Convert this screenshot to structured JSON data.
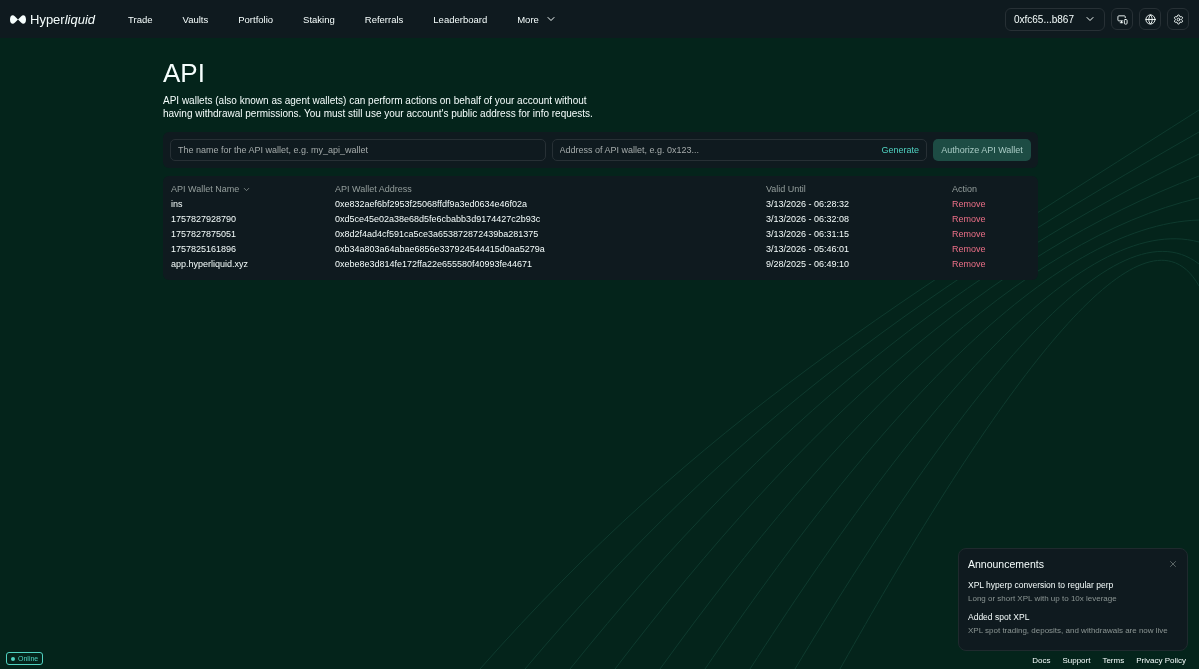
{
  "brand": {
    "name": "Hyper",
    "name_italic": "liquid"
  },
  "nav": [
    {
      "label": "Trade"
    },
    {
      "label": "Vaults"
    },
    {
      "label": "Portfolio"
    },
    {
      "label": "Staking"
    },
    {
      "label": "Referrals"
    },
    {
      "label": "Leaderboard"
    },
    {
      "label": "More",
      "dropdown": true
    }
  ],
  "account": {
    "address": "0xfc65...b867"
  },
  "page": {
    "title": "API",
    "description": "API wallets (also known as agent wallets) can perform actions on behalf of your account without having withdrawal permissions. You must still use your account's public address for info requests."
  },
  "form": {
    "name_field": {
      "placeholder": "The name for the API wallet, e.g. my_api_wallet"
    },
    "address_field": {
      "placeholder": "Address of API wallet, e.g. 0x123..."
    },
    "generate_button": "Generate",
    "authorize_button": {
      "label": "Authorize API Wallet",
      "disabled": true
    }
  },
  "table": {
    "columns": [
      {
        "label": "API Wallet Name",
        "sorted": true
      },
      {
        "label": "API Wallet Address",
        "sorted": false
      },
      {
        "label": "Valid Until",
        "sorted": false
      },
      {
        "label": "Action",
        "sorted": false
      }
    ],
    "rows": [
      {
        "name": "ins",
        "address": "0xe832aef6bf2953f25068ffdf9a3ed0634e46f02a",
        "valid_until": "3/13/2026 - 06:28:32",
        "action": "Remove"
      },
      {
        "name": "1757827928790",
        "address": "0xd5ce45e02a38e68d5fe6cbabb3d9174427c2b93c",
        "valid_until": "3/13/2026 - 06:32:08",
        "action": "Remove"
      },
      {
        "name": "1757827875051",
        "address": "0x8d2f4ad4cf591ca5ce3a653872872439ba281375",
        "valid_until": "3/13/2026 - 06:31:15",
        "action": "Remove"
      },
      {
        "name": "1757825161896",
        "address": "0xb34a803a64abae6856e337924544415d0aa5279a",
        "valid_until": "3/13/2026 - 05:46:01",
        "action": "Remove"
      },
      {
        "name": "app.hyperliquid.xyz",
        "address": "0xebe8e3d814fe172ffa22e655580f40993fe44671",
        "valid_until": "9/28/2025 - 06:49:10",
        "action": "Remove"
      }
    ]
  },
  "announcements": {
    "title": "Announcements",
    "items": [
      {
        "title": "XPL hyperp conversion to regular perp",
        "body": "Long or short XPL with up to 10x leverage"
      },
      {
        "title": "Added spot XPL",
        "body": "XPL spot trading, deposits, and withdrawals are now live"
      }
    ]
  },
  "status": {
    "label": "Online",
    "online": true
  },
  "footer": [
    {
      "label": "Docs"
    },
    {
      "label": "Support"
    },
    {
      "label": "Terms"
    },
    {
      "label": "Privacy Policy"
    }
  ]
}
